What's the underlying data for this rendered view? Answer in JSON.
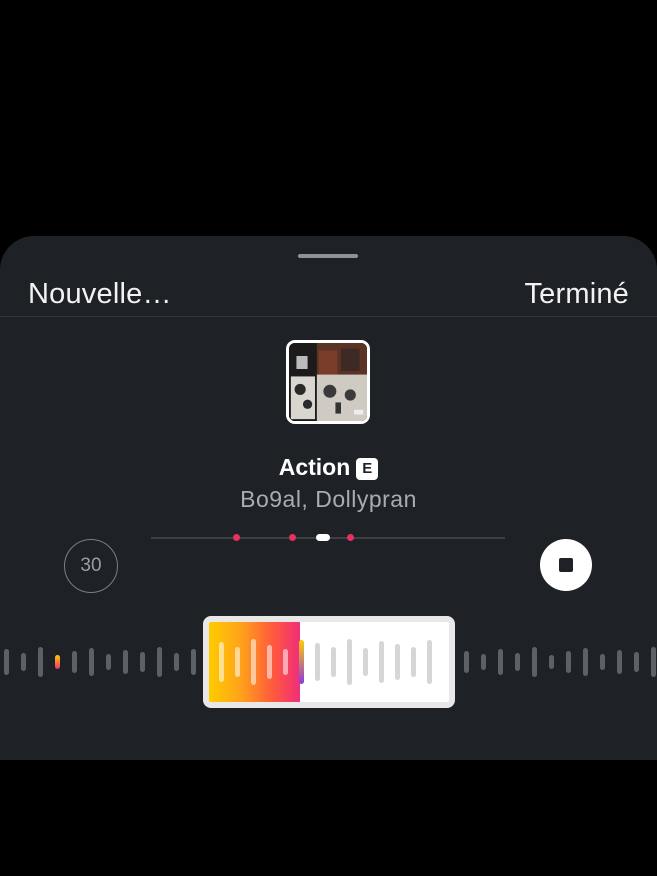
{
  "header": {
    "left_label": "Nouvelle…",
    "right_label": "Terminé"
  },
  "track": {
    "title": "Action",
    "explicit_badge": "E",
    "artist": "Bo9al, Dollypran"
  },
  "controls": {
    "duration_label": "30",
    "clip_progress": 0.38
  },
  "colors": {
    "sheet_background": "#1e2125",
    "accent_pink": "#e8305d",
    "gradient_start": "#ffcc00",
    "gradient_end": "#f02e7a"
  },
  "icons": {
    "stop": "stop-icon",
    "album_art": "album-art-image"
  }
}
